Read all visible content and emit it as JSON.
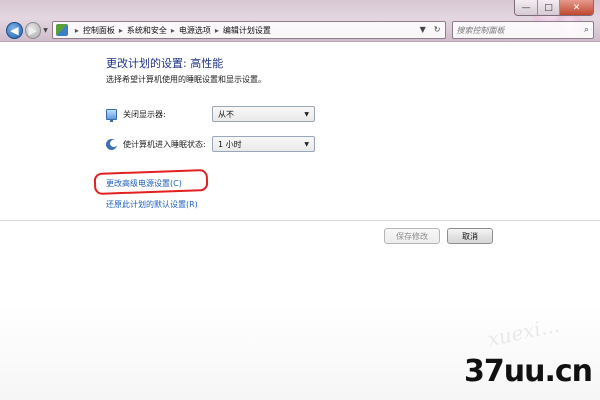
{
  "window": {
    "caption": {
      "minimize": "—",
      "maximize": "□",
      "close": "✕"
    }
  },
  "navigation": {
    "back_icon": "back-arrow-icon",
    "forward_icon": "forward-arrow-icon",
    "back_glyph": "◀",
    "forward_glyph": "▶",
    "history_dropdown_glyph": "▼",
    "breadcrumbs": [
      "控制面板",
      "系统和安全",
      "电源选项",
      "编辑计划设置"
    ],
    "breadcrumb_separator": "▸",
    "address_dropdown_glyph": "▼",
    "refresh_glyph": "↻",
    "search": {
      "placeholder": "搜索控制面板",
      "icon_glyph": "⌕"
    }
  },
  "main": {
    "heading": "更改计划的设置: 高性能",
    "subtext": "选择希望计算机使用的睡眠设置和显示设置。",
    "settings": [
      {
        "label": "关闭显示器:",
        "value": "从不",
        "icon": "monitor-icon"
      },
      {
        "label": "使计算机进入睡眠状态:",
        "value": "1 小时",
        "icon": "moon-icon"
      }
    ],
    "dropdown_glyph": "▼",
    "links": {
      "advanced": "更改高级电源设置(C)",
      "restore": "还原此计划的默认设置(R)"
    },
    "buttons": {
      "save": "保存修改",
      "cancel": "取消"
    }
  },
  "watermark": {
    "logo_text": "37uu.cn",
    "faint_text": "xuexi..."
  },
  "colors": {
    "heading": "#1e3287",
    "link": "#1c5fbf",
    "annotation_oval": "#e22020",
    "titlebar": "#d7c7d3"
  }
}
